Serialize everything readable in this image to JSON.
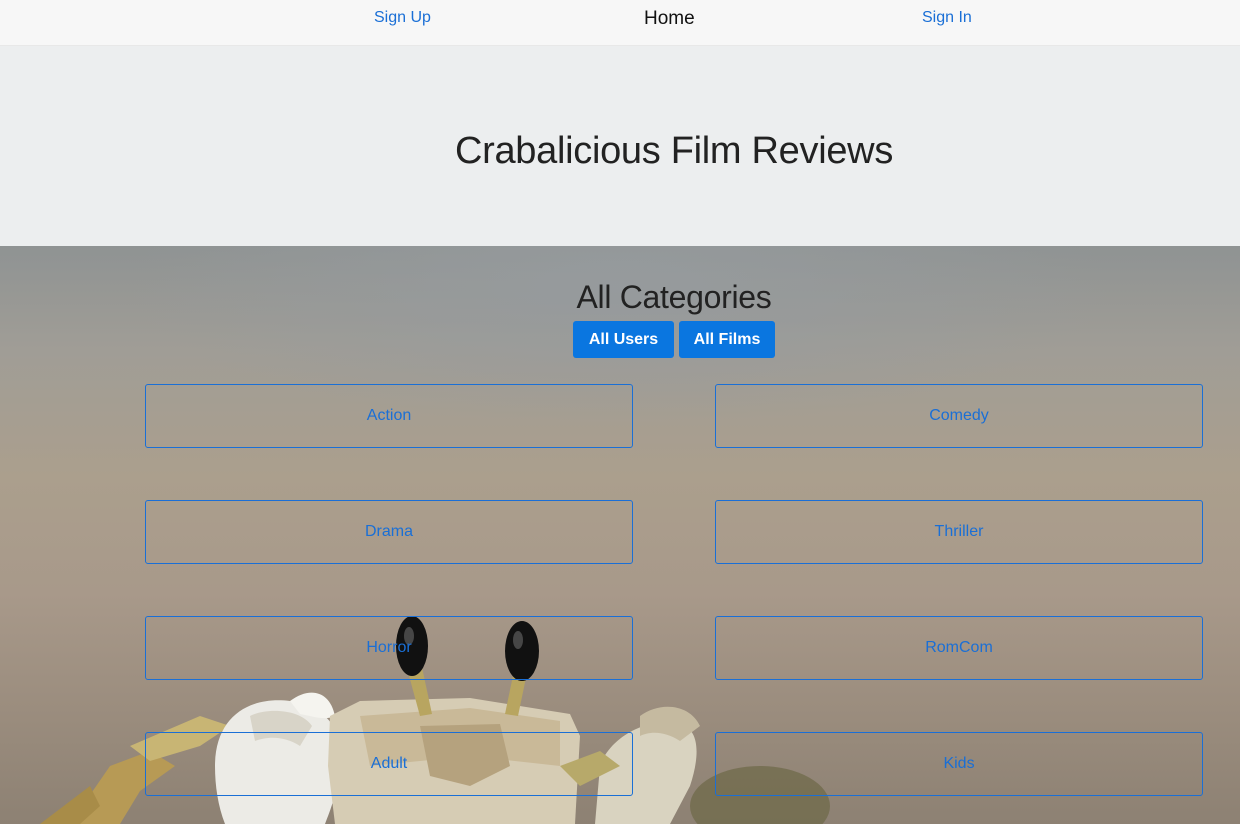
{
  "nav": {
    "sign_up": "Sign Up",
    "home": "Home",
    "sign_in": "Sign In"
  },
  "header": {
    "title": "Crabalicious Film Reviews"
  },
  "main": {
    "heading": "All Categories",
    "buttons": {
      "all_users": "All Users",
      "all_films": "All Films"
    },
    "categories": [
      {
        "label": "Action"
      },
      {
        "label": "Comedy"
      },
      {
        "label": "Drama"
      },
      {
        "label": "Thriller"
      },
      {
        "label": "Horror"
      },
      {
        "label": "RomCom"
      },
      {
        "label": "Adult"
      },
      {
        "label": "Kids"
      }
    ]
  },
  "background": {
    "image": "crab photograph"
  },
  "colors": {
    "accent": "#0a76e0",
    "link": "#1a6fd6",
    "nav_bg": "#f7f7f7",
    "jumbotron_bg": "#eceeef"
  }
}
